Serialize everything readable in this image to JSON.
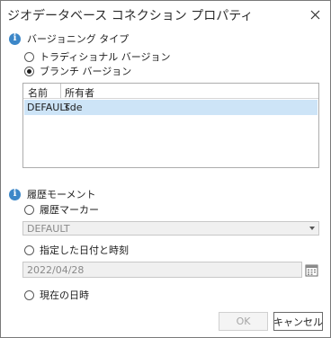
{
  "dialog": {
    "title": "ジオデータベース コネクション プロパティ",
    "close_icon": "close-icon"
  },
  "versioning": {
    "header_icon": "info-icon",
    "header": "バージョニング タイプ",
    "options": [
      {
        "label": "トラディショナル バージョン",
        "checked": false
      },
      {
        "label": "ブランチ バージョン",
        "checked": true
      }
    ],
    "table": {
      "columns": [
        "名前",
        "所有者"
      ],
      "rows": [
        {
          "name": "DEFAULT",
          "owner": "sde",
          "selected": true
        }
      ]
    }
  },
  "history": {
    "header_icon": "info-icon",
    "header": "履歴モーメント",
    "marker_option": {
      "label": "履歴マーカー",
      "checked": false
    },
    "marker_select": {
      "value": "DEFAULT",
      "disabled": true
    },
    "datetime_option": {
      "label": "指定した日付と時刻",
      "checked": false
    },
    "date_field": {
      "value": "2022/04/28",
      "disabled": true,
      "button_icon": "calendar-icon"
    },
    "now_option": {
      "label": "現在の日時",
      "checked": false
    }
  },
  "footer": {
    "ok_label": "OK",
    "cancel_label": "キャンセル"
  },
  "colors": {
    "selected_row": "#cde4f7",
    "info_icon": "#3c87c8",
    "disabled_bg": "#f0f0f0",
    "disabled_text": "#8a8a8a"
  }
}
